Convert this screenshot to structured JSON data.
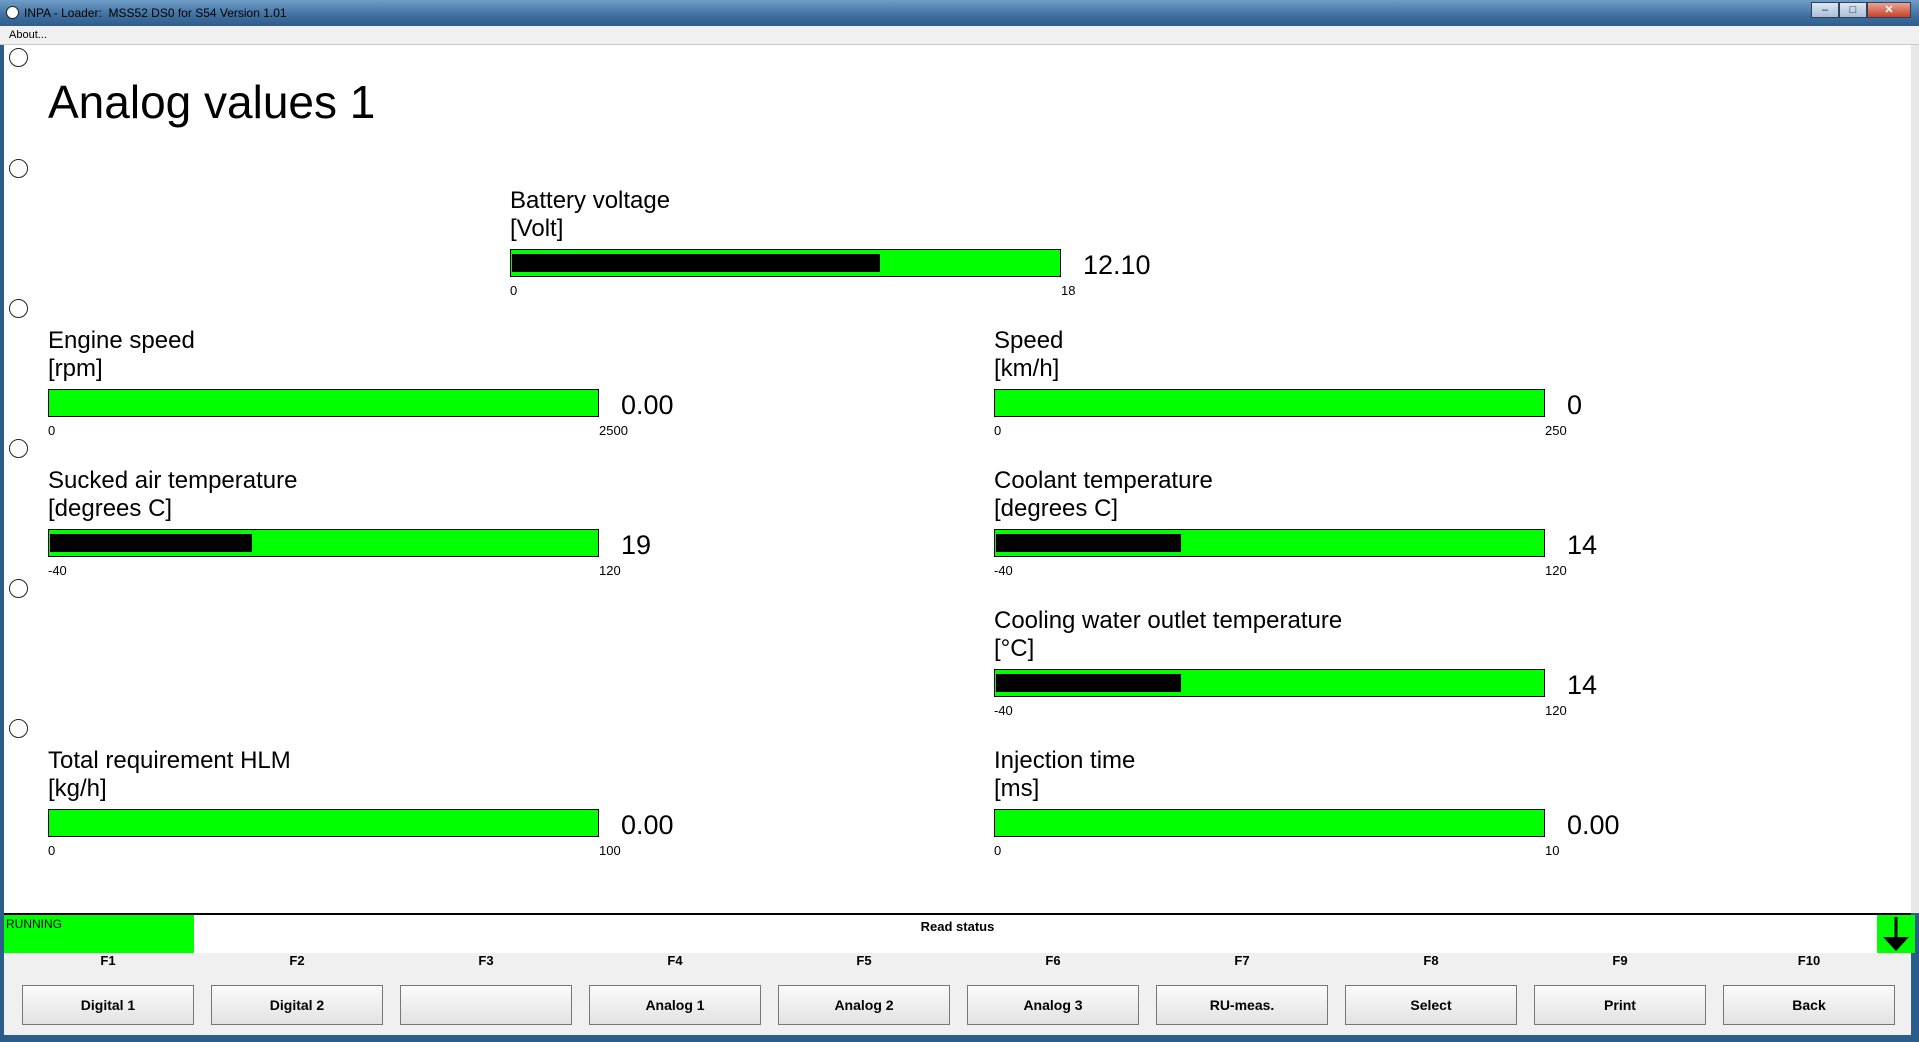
{
  "window": {
    "title": "INPA - Loader:  MSS52 DS0 for S54 Version 1.01",
    "minimize": "–",
    "maximize": "□",
    "close": "✕"
  },
  "menu": {
    "about": "About..."
  },
  "page": {
    "title": "Analog values 1"
  },
  "gauges": [
    {
      "id": "battery-voltage",
      "label": "Battery voltage",
      "unit": "[Volt]",
      "value": "12.10",
      "min": "0",
      "max": "18",
      "fill_fraction": 0.672
    },
    {
      "id": "engine-speed",
      "label": "Engine speed",
      "unit": "[rpm]",
      "value": "0.00",
      "min": "0",
      "max": "2500",
      "fill_fraction": 0
    },
    {
      "id": "speed",
      "label": "Speed",
      "unit": "[km/h]",
      "value": "0",
      "min": "0",
      "max": "250",
      "fill_fraction": 0
    },
    {
      "id": "sucked-air-temperature",
      "label": "Sucked air temperature",
      "unit": "[degrees C]",
      "value": "19",
      "min": "-40",
      "max": "120",
      "fill_fraction": 0.369
    },
    {
      "id": "coolant-temperature",
      "label": "Coolant temperature",
      "unit": "[degrees C]",
      "value": "14",
      "min": "-40",
      "max": "120",
      "fill_fraction": 0.3375
    },
    {
      "id": "cooling-water-outlet-temperature",
      "label": "Cooling water outlet temperature",
      "unit": "[°C]",
      "value": "14",
      "min": "-40",
      "max": "120",
      "fill_fraction": 0.3375
    },
    {
      "id": "total-requirement-hlm",
      "label": "Total requirement HLM",
      "unit": "[kg/h]",
      "value": "0.00",
      "min": "0",
      "max": "100",
      "fill_fraction": 0
    },
    {
      "id": "injection-time",
      "label": "Injection time",
      "unit": "[ms]",
      "value": "0.00",
      "min": "0",
      "max": "10",
      "fill_fraction": 0
    }
  ],
  "status": {
    "running": "RUNNING",
    "read_status": "Read status"
  },
  "fkeys": [
    {
      "key": "F1",
      "label": "Digital 1"
    },
    {
      "key": "F2",
      "label": "Digital 2"
    },
    {
      "key": "F3",
      "label": ""
    },
    {
      "key": "F4",
      "label": "Analog 1"
    },
    {
      "key": "F5",
      "label": "Analog 2"
    },
    {
      "key": "F6",
      "label": "Analog 3"
    },
    {
      "key": "F7",
      "label": "RU-meas."
    },
    {
      "key": "F8",
      "label": "Select"
    },
    {
      "key": "F9",
      "label": "Print"
    },
    {
      "key": "F10",
      "label": "Back"
    }
  ],
  "colors": {
    "bar_green": "#00ff00",
    "bar_fill": "#000000",
    "status_green": "#00ff00"
  }
}
